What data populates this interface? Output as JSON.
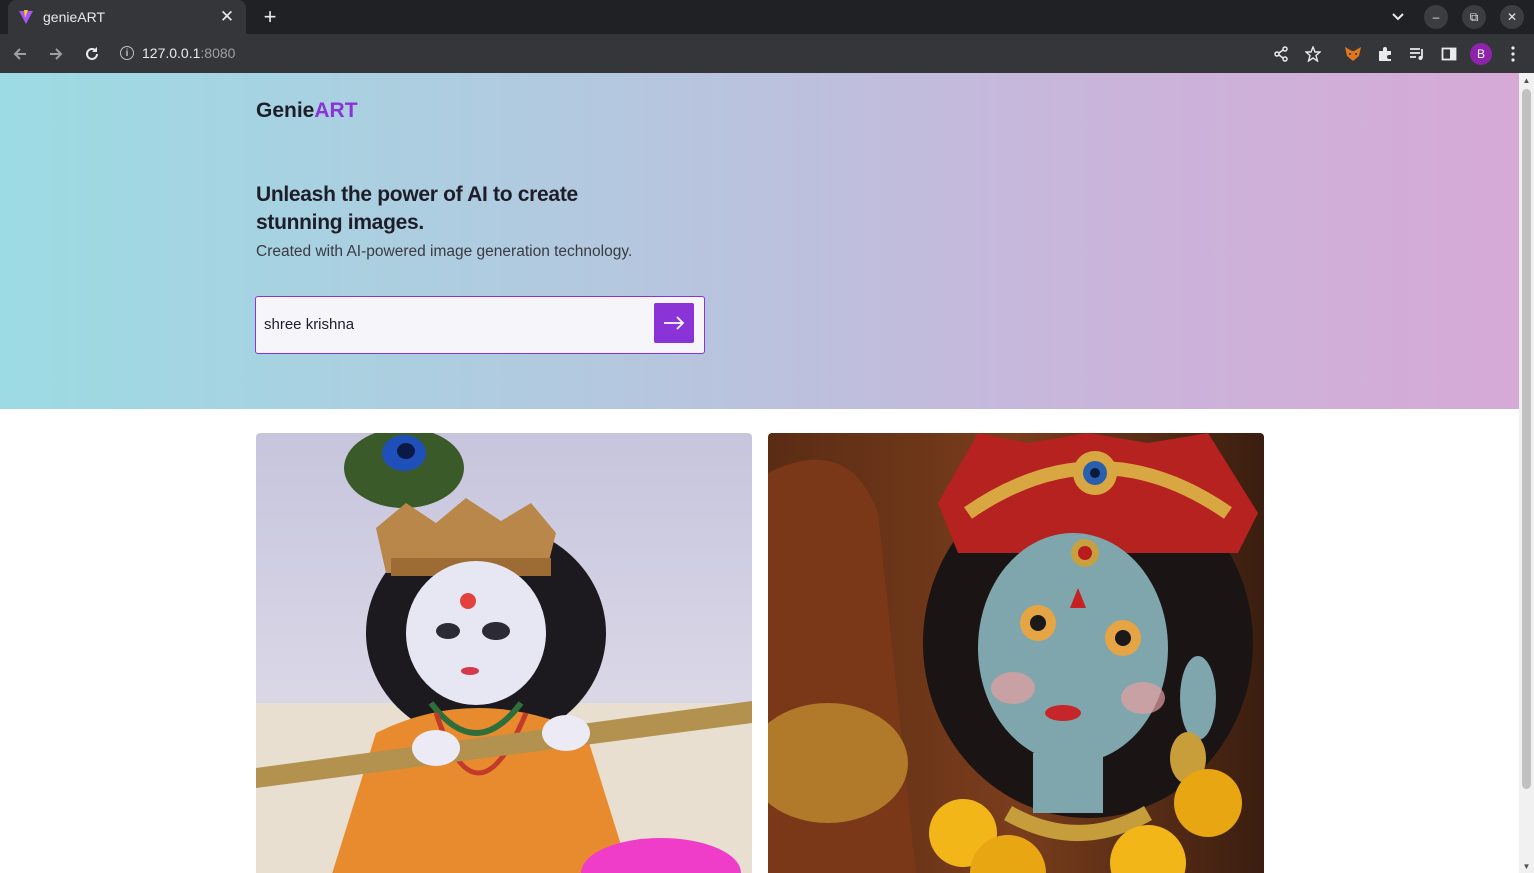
{
  "browser": {
    "tab_title": "genieART",
    "url_host": "127.0.0.1",
    "url_port": ":8080",
    "profile_initial": "B"
  },
  "page": {
    "logo_main": "Genie",
    "logo_accent": "ART",
    "headline": "Unleash the power of AI to create stunning images.",
    "subheadline": "Created with AI-powered image generation technology.",
    "search_value": "shree krishna",
    "accent_color": "#8a34d8"
  },
  "gallery": {
    "images": [
      {
        "subject": "krishna-figurine-with-flute"
      },
      {
        "subject": "krishna-figurine-portrait"
      }
    ]
  }
}
